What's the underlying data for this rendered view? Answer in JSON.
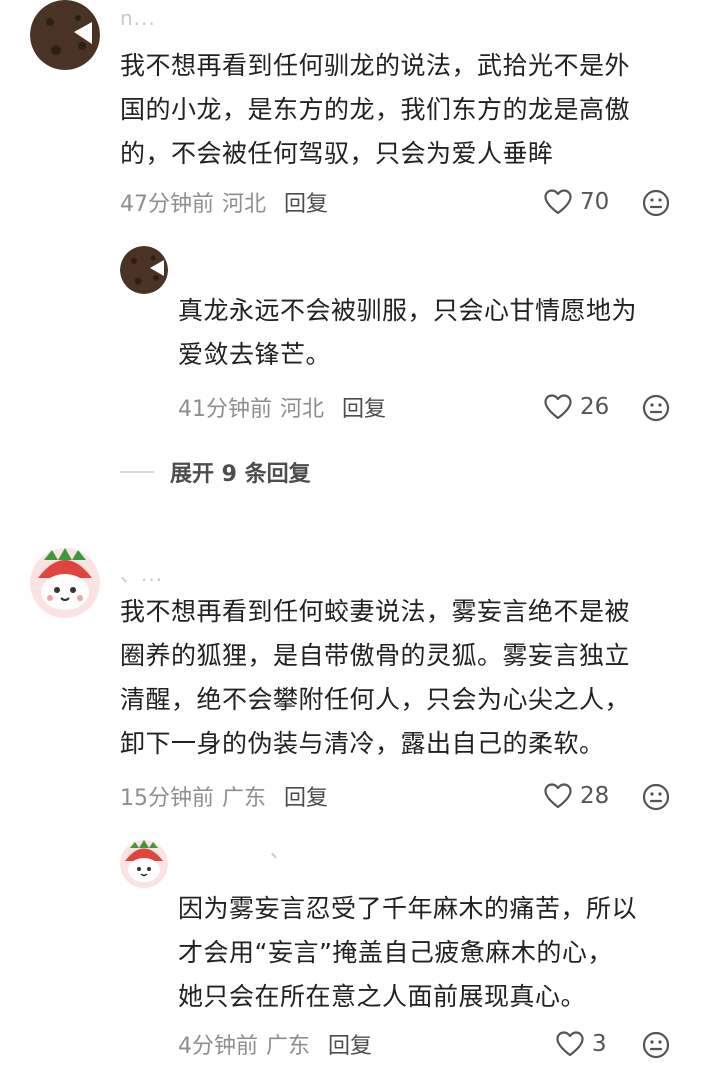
{
  "comments": [
    {
      "username": "n...",
      "lines": [
        "我不想再看到任何驯龙的说法，武拾光不是外",
        "国的小龙，是东方的龙，我们东方的龙是高傲",
        "的，不会被任何驾驭，只会为爱人垂眸"
      ],
      "time": "47分钟前",
      "location": "河北",
      "reply_label": "回复",
      "likes": "70",
      "reply": {
        "lines": [
          "真龙永远不会被驯服，只会心甘情愿地为",
          "爱敛去锋芒。"
        ],
        "time": "41分钟前",
        "location": "河北",
        "reply_label": "回复",
        "likes": "26"
      },
      "expand_label": "展开 9 条回复"
    },
    {
      "username": "、...",
      "lines": [
        "我不想再看到任何蛟妻说法，雾妄言绝不是被",
        "圈养的狐狸，是自带傲骨的灵狐。雾妄言独立",
        "清醒，绝不会攀附任何人，只会为心尖之人，",
        "卸下一身的伪装与清冷，露出自己的柔软。"
      ],
      "time": "15分钟前",
      "location": "广东",
      "reply_label": "回复",
      "likes": "28",
      "reply": {
        "username": "、",
        "lines": [
          "因为雾妄言忍受了千年麻木的痛苦，所以",
          "才会用“妄言”掩盖自己疲惫麻木的心，",
          "她只会在所在意之人面前展现真心。"
        ],
        "time": "4分钟前",
        "location": "广东",
        "reply_label": "回复",
        "likes": "3"
      }
    }
  ],
  "icons": {
    "like": "heart-outline-icon",
    "emoji": "neutral-face-icon"
  },
  "colors": {
    "text": "#222222",
    "meta": "#8e8e8e",
    "strawberry": "#e0443f"
  }
}
